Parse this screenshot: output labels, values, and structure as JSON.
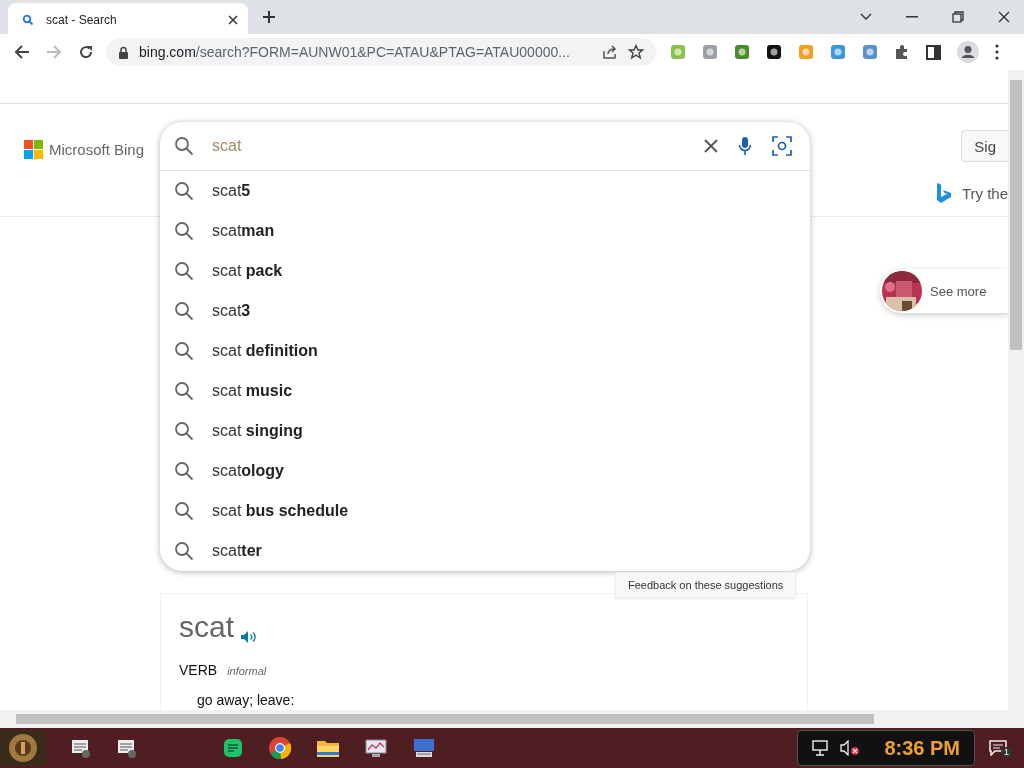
{
  "browser": {
    "tab": {
      "title": "scat - Search",
      "selected": true
    },
    "url_host": "bing.com",
    "url_rest": "/search?FORM=AUNW01&PC=ATAU&PTAG=ATAU00000...",
    "forward_disabled": true
  },
  "page": {
    "logo": "Microsoft Bing",
    "sign_in": "Sig",
    "try_text": "Try the",
    "see_more": "See more",
    "search": {
      "value": "scat"
    },
    "suggestions": [
      "scat**5**",
      "scat**man**",
      "scat **pack**",
      "scat**3**",
      "scat **definition**",
      "scat **music**",
      "scat **singing**",
      "scat**ology**",
      "scat **bus schedule**",
      "scat**ter**"
    ],
    "feedback": "Feedback on these suggestions",
    "definition": {
      "word": "scat",
      "pos": "VERB",
      "register": "informal",
      "sense": "go away; leave:"
    }
  },
  "taskbar": {
    "time": "8:36 PM",
    "notification_count": "1"
  }
}
